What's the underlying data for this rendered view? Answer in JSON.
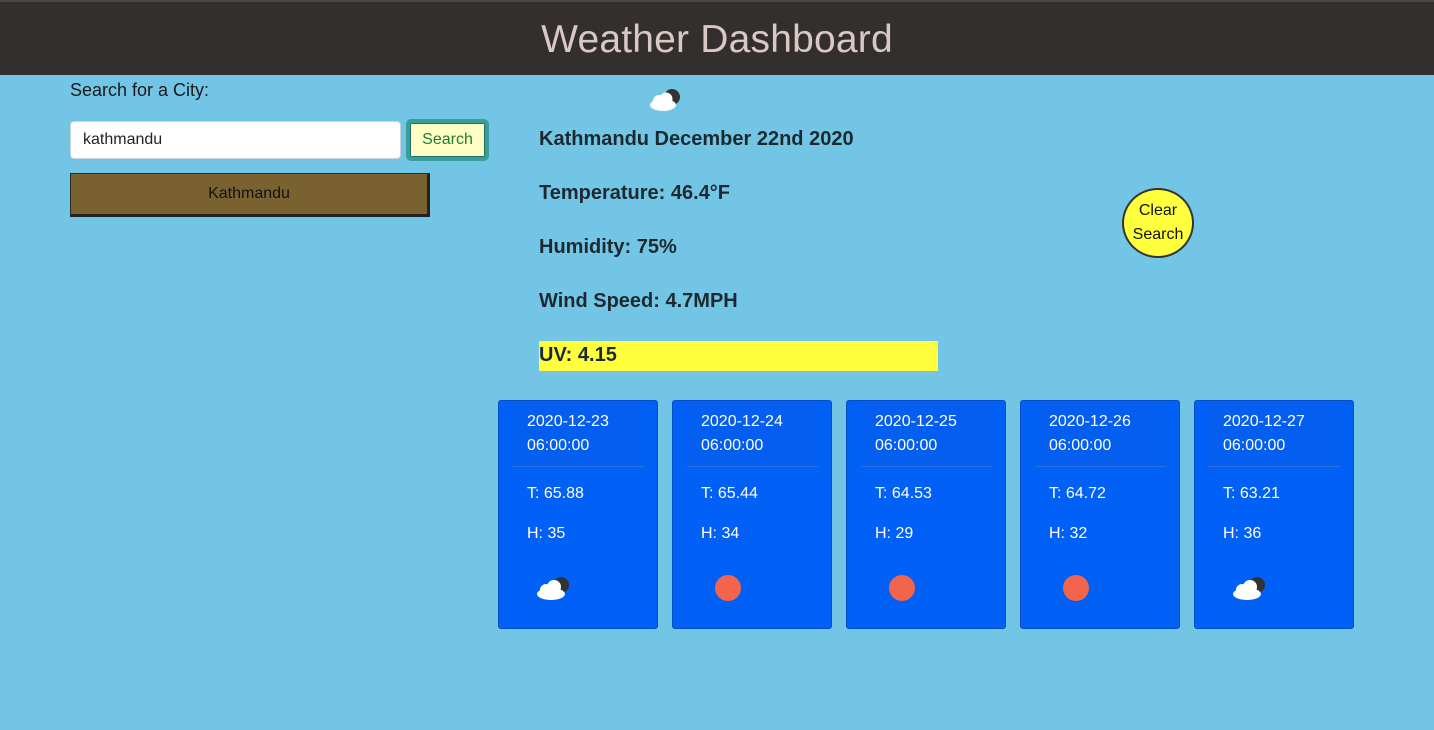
{
  "header": {
    "title": "Weather Dashboard"
  },
  "search": {
    "label": "Search for a City:",
    "input_value": "kathmandu",
    "button_label": "Search"
  },
  "history": {
    "items": [
      {
        "label": "Kathmandu"
      }
    ]
  },
  "current": {
    "icon": "partly-cloudy-icon",
    "title": "Kathmandu December 22nd 2020",
    "temperature": "Temperature: 46.4°F",
    "humidity": "Humidity: 75%",
    "wind": "Wind Speed: 4.7MPH",
    "uv": "UV: 4.15",
    "uv_color": "#ffff3d"
  },
  "clear_button": {
    "line1": "Clear",
    "line2": "Search"
  },
  "colors": {
    "background": "#73c5e5",
    "header": "#332f2f",
    "card": "#0160f5"
  },
  "forecast": [
    {
      "date": "2020-12-23",
      "time": "06:00:00",
      "temp": "T: 65.88",
      "hum": "H: 35",
      "icon": "partly-cloudy-icon"
    },
    {
      "date": "2020-12-24",
      "time": "06:00:00",
      "temp": "T: 65.44",
      "hum": "H: 34",
      "icon": "sun-icon"
    },
    {
      "date": "2020-12-25",
      "time": "06:00:00",
      "temp": "T: 64.53",
      "hum": "H: 29",
      "icon": "sun-icon"
    },
    {
      "date": "2020-12-26",
      "time": "06:00:00",
      "temp": "T: 64.72",
      "hum": "H: 32",
      "icon": "sun-icon"
    },
    {
      "date": "2020-12-27",
      "time": "06:00:00",
      "temp": "T: 63.21",
      "hum": "H: 36",
      "icon": "partly-cloudy-icon"
    }
  ]
}
